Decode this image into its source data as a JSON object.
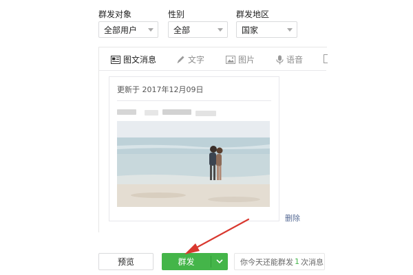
{
  "filters": {
    "target": {
      "label": "群发对象",
      "value": "全部用户"
    },
    "gender": {
      "label": "性别",
      "value": "全部"
    },
    "region": {
      "label": "群发地区",
      "value": "国家"
    }
  },
  "tabs": [
    {
      "label": "图文消息",
      "icon": "news-icon",
      "active": true
    },
    {
      "label": "文字",
      "icon": "pencil-icon",
      "active": false
    },
    {
      "label": "图片",
      "icon": "image-icon",
      "active": false
    },
    {
      "label": "语音",
      "icon": "microphone-icon",
      "active": false
    }
  ],
  "article": {
    "updated": "更新于 2017年12月09日",
    "thumbnail": "beach-couple-photo"
  },
  "actions": {
    "delete": "删除",
    "preview": "预览",
    "send": "群发",
    "quota_prefix": "你今天还能群发",
    "quota_count": "1",
    "quota_suffix": "次消息"
  },
  "colors": {
    "accent_green": "#44b549",
    "link_blue": "#576b95",
    "annotation_red": "#d9382f"
  }
}
